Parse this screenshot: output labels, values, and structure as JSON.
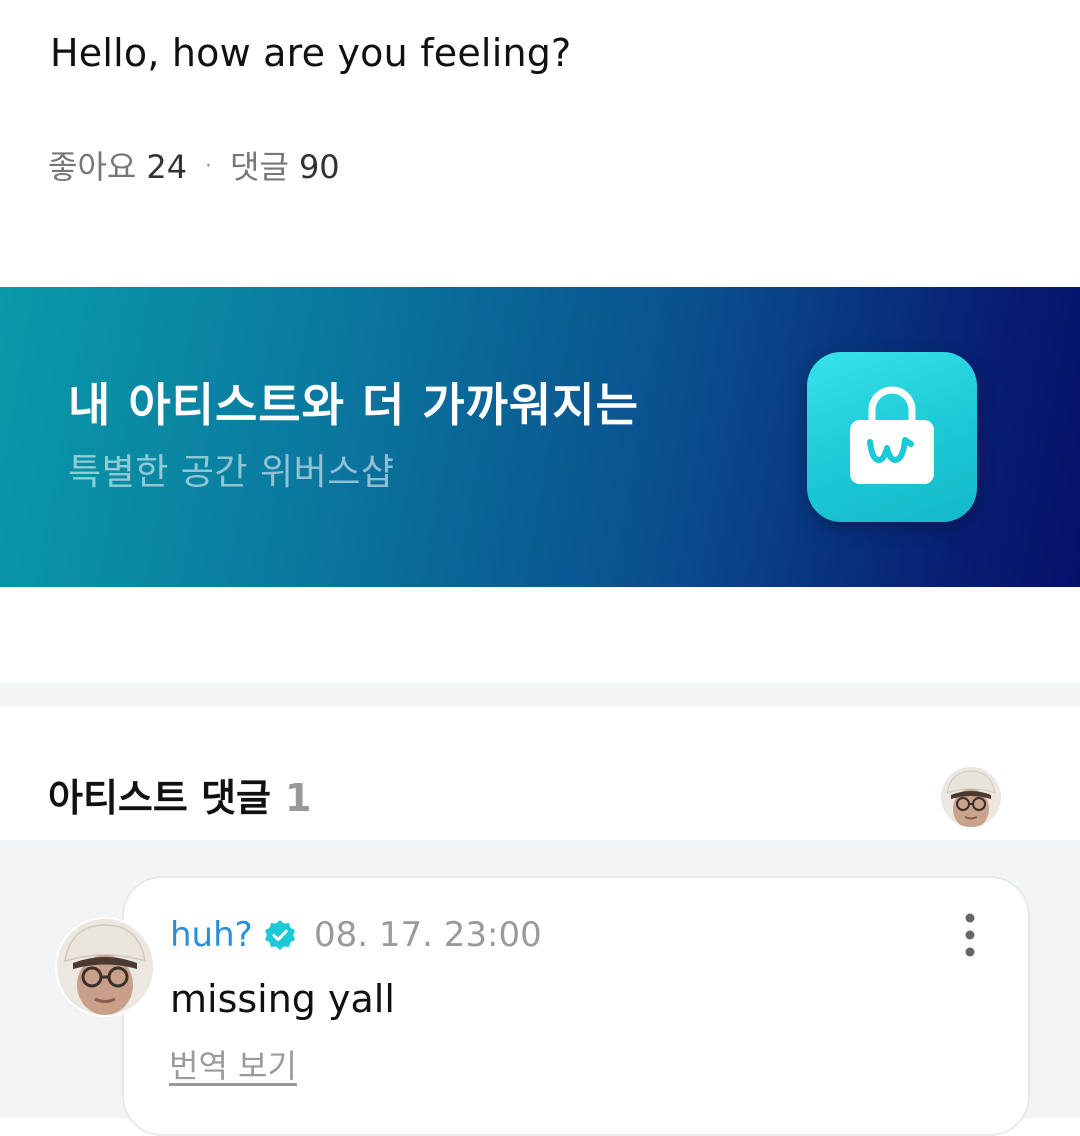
{
  "post": {
    "text": "Hello, how are you feeling?",
    "likes_label": "좋아요",
    "likes_count": "24",
    "separator": "·",
    "comments_label": "댓글",
    "comments_count": "90"
  },
  "banner": {
    "title": "내 아티스트와 더 가까워지는",
    "subtitle": "특별한 공간 위버스샵",
    "icon": "weverse-shop-bag-icon",
    "colors": {
      "gradient_start": "#0a9aa8",
      "gradient_end": "#06106a",
      "icon_bg": "#1cc9d6"
    }
  },
  "artist_comments": {
    "title": "아티스트 댓글",
    "count": "1",
    "comments": [
      {
        "author": "huh?",
        "verified": true,
        "time": "08. 17. 23:00",
        "text": "missing yall",
        "translate_label": "번역 보기"
      }
    ]
  },
  "colors": {
    "author": "#2a8fd9",
    "verified_badge": "#1cc9d6",
    "muted_text": "#9a9a9a",
    "section_bg": "#f3f4f6"
  }
}
